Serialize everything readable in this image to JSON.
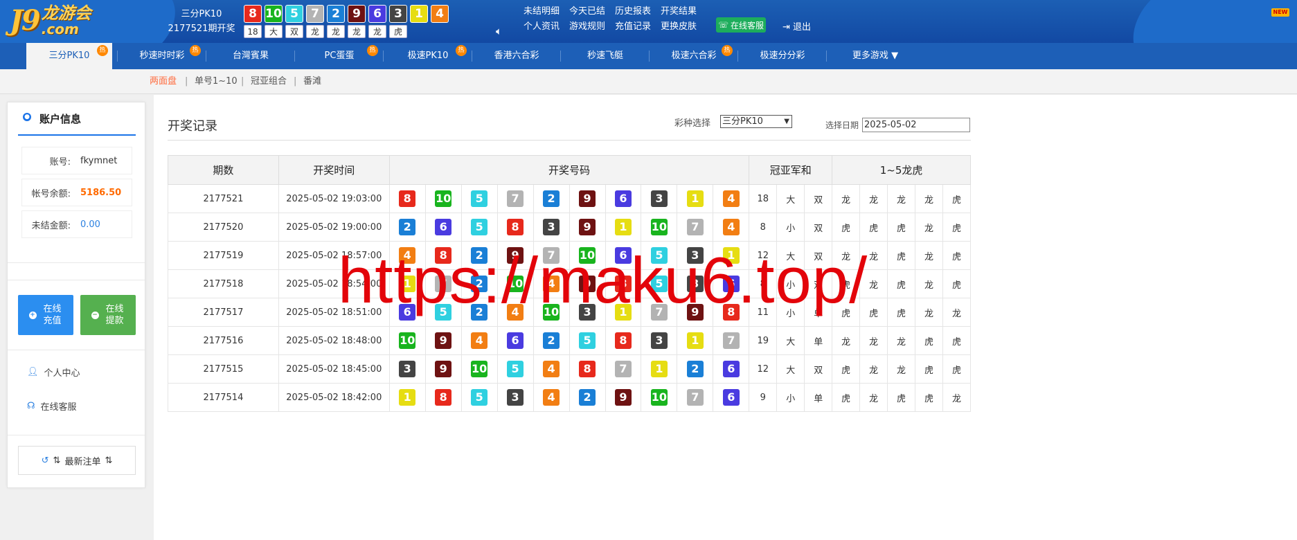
{
  "colors": {
    "1": "#e6dd12",
    "2": "#1a7fd6",
    "3": "#444444",
    "4": "#f27e13",
    "5": "#2fd0e0",
    "6": "#4a3be0",
    "7": "#b3b3b3",
    "8": "#e7291c",
    "9": "#6e1212",
    "10": "#19b41e"
  },
  "header": {
    "logo_main": "J9",
    "logo_cn": "龙游会",
    "logo_com": ".com",
    "game_name": "三分PK10",
    "period_text": "2177521期开奖",
    "latest_balls": [
      8,
      10,
      5,
      7,
      2,
      9,
      6,
      3,
      1,
      4
    ],
    "latest_stats": [
      "18",
      "大",
      "双",
      "龙",
      "龙",
      "龙",
      "龙",
      "虎"
    ],
    "links": [
      "未结明细",
      "今天已结",
      "历史报表",
      "开奖结果",
      "个人资讯",
      "游戏规则",
      "充值记录",
      "更换皮肤"
    ],
    "service_label": "在线客服",
    "logout_label": "退出",
    "new_badge": "NEW"
  },
  "nav": {
    "items": [
      "三分PK10",
      "秒速时时彩",
      "台灣賓果",
      "PC蛋蛋",
      "极速PK10",
      "香港六合彩",
      "秒速飞艇",
      "极速六合彩",
      "极速分分彩",
      "更多游戏"
    ],
    "hot_label": "热"
  },
  "subnav": [
    "两面盘",
    "单号1~10",
    "冠亚组合",
    "番滩"
  ],
  "sidebar": {
    "title": "账户信息",
    "account_label": "账号:",
    "account_value": "fkymnet",
    "balance_label": "帐号余额:",
    "balance_value": "5186.50",
    "unsettled_label": "未结金额:",
    "unsettled_value": "0.00",
    "deposit_label": "在线充值",
    "withdraw_label": "在线提款",
    "personal_center": "个人中心",
    "online_service": "在线客服",
    "latest_bets": "最新注单"
  },
  "main": {
    "title": "开奖记录",
    "lottery_label": "彩种选择",
    "lottery_value": "三分PK10",
    "date_label": "选择日期",
    "date_value": "2025-05-02",
    "columns": [
      "期数",
      "开奖时间",
      "开奖号码",
      "冠亚军和",
      "1~5龙虎"
    ]
  },
  "rows": [
    {
      "period": "2177521",
      "time": "2025-05-02 19:03:00",
      "balls": [
        8,
        10,
        5,
        7,
        2,
        9,
        6,
        3,
        1,
        4
      ],
      "sum": "18",
      "size": "大",
      "parity": "双",
      "dt": [
        "龙",
        "龙",
        "龙",
        "龙",
        "虎"
      ]
    },
    {
      "period": "2177520",
      "time": "2025-05-02 19:00:00",
      "balls": [
        2,
        6,
        5,
        8,
        3,
        9,
        1,
        10,
        7,
        4
      ],
      "sum": "8",
      "size": "小",
      "parity": "双",
      "dt": [
        "虎",
        "虎",
        "虎",
        "龙",
        "虎"
      ]
    },
    {
      "period": "2177519",
      "time": "2025-05-02 18:57:00",
      "balls": [
        4,
        8,
        2,
        9,
        7,
        10,
        6,
        5,
        3,
        1
      ],
      "sum": "12",
      "size": "大",
      "parity": "双",
      "dt": [
        "龙",
        "龙",
        "虎",
        "龙",
        "虎"
      ]
    },
    {
      "period": "2177518",
      "time": "2025-05-02 18:54:00",
      "balls": [
        1,
        7,
        2,
        10,
        4,
        9,
        8,
        5,
        3,
        6
      ],
      "sum": "8",
      "size": "小",
      "parity": "双",
      "dt": [
        "虎",
        "龙",
        "虎",
        "龙",
        "虎"
      ]
    },
    {
      "period": "2177517",
      "time": "2025-05-02 18:51:00",
      "balls": [
        6,
        5,
        2,
        4,
        10,
        3,
        1,
        7,
        9,
        8
      ],
      "sum": "11",
      "size": "小",
      "parity": "单",
      "dt": [
        "虎",
        "虎",
        "虎",
        "龙",
        "龙"
      ]
    },
    {
      "period": "2177516",
      "time": "2025-05-02 18:48:00",
      "balls": [
        10,
        9,
        4,
        6,
        2,
        5,
        8,
        3,
        1,
        7
      ],
      "sum": "19",
      "size": "大",
      "parity": "单",
      "dt": [
        "龙",
        "龙",
        "龙",
        "虎",
        "虎"
      ]
    },
    {
      "period": "2177515",
      "time": "2025-05-02 18:45:00",
      "balls": [
        3,
        9,
        10,
        5,
        4,
        8,
        7,
        1,
        2,
        6
      ],
      "sum": "12",
      "size": "大",
      "parity": "双",
      "dt": [
        "虎",
        "龙",
        "龙",
        "虎",
        "虎"
      ]
    },
    {
      "period": "2177514",
      "time": "2025-05-02 18:42:00",
      "balls": [
        1,
        8,
        5,
        3,
        4,
        2,
        9,
        10,
        7,
        6
      ],
      "sum": "9",
      "size": "小",
      "parity": "单",
      "dt": [
        "虎",
        "龙",
        "虎",
        "虎",
        "龙"
      ]
    }
  ],
  "watermark": "https://maku6.top/"
}
